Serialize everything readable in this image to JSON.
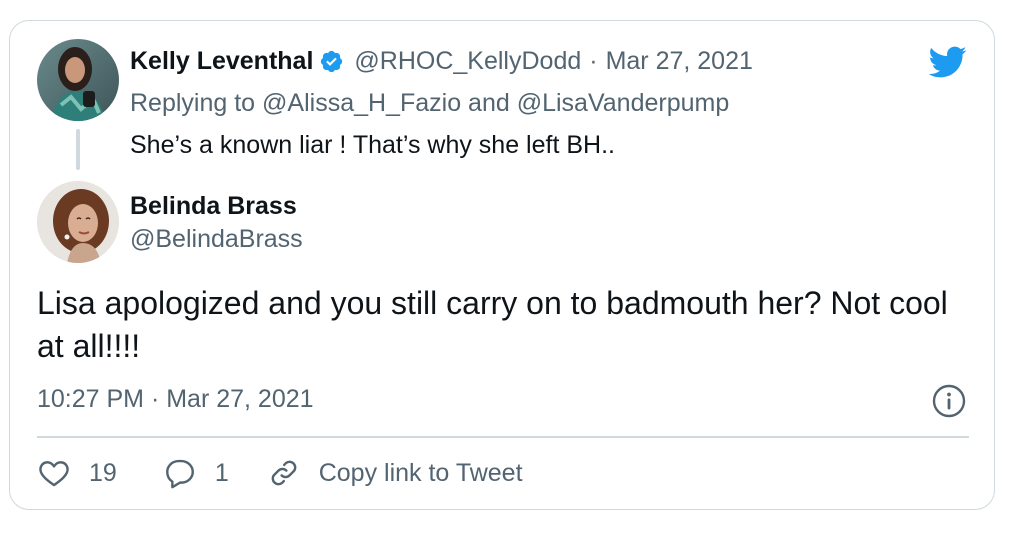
{
  "parent_tweet": {
    "author_name": "Kelly Leventhal",
    "author_handle": "@RHOC_KellyDodd",
    "separator": "·",
    "date": "Mar 27, 2021",
    "replying_prefix": "Replying to",
    "replying_to_1": "@Alissa_H_Fazio",
    "replying_and": "and",
    "replying_to_2": "@LisaVanderpump",
    "text": "She’s a known liar ! That’s why she left BH.."
  },
  "main_tweet": {
    "author_name": "Belinda Brass",
    "author_handle": "@BelindaBrass",
    "text": "Lisa apologized and you still carry on to badmouth her? Not cool at all!!!!",
    "timestamp": "10:27 PM · Mar 27, 2021"
  },
  "actions": {
    "like_count": "19",
    "reply_count": "1",
    "copy_link_label": "Copy link to Tweet"
  },
  "icons": {
    "brand": "twitter-bird-icon",
    "verified": "verified-badge-icon",
    "info": "info-icon",
    "like": "heart-icon",
    "reply": "speech-bubble-icon",
    "copy_link": "link-icon"
  },
  "colors": {
    "brand_blue": "#1d9bf0",
    "text_primary": "#0f1419",
    "text_secondary": "#536471",
    "border": "#cfd9de"
  }
}
